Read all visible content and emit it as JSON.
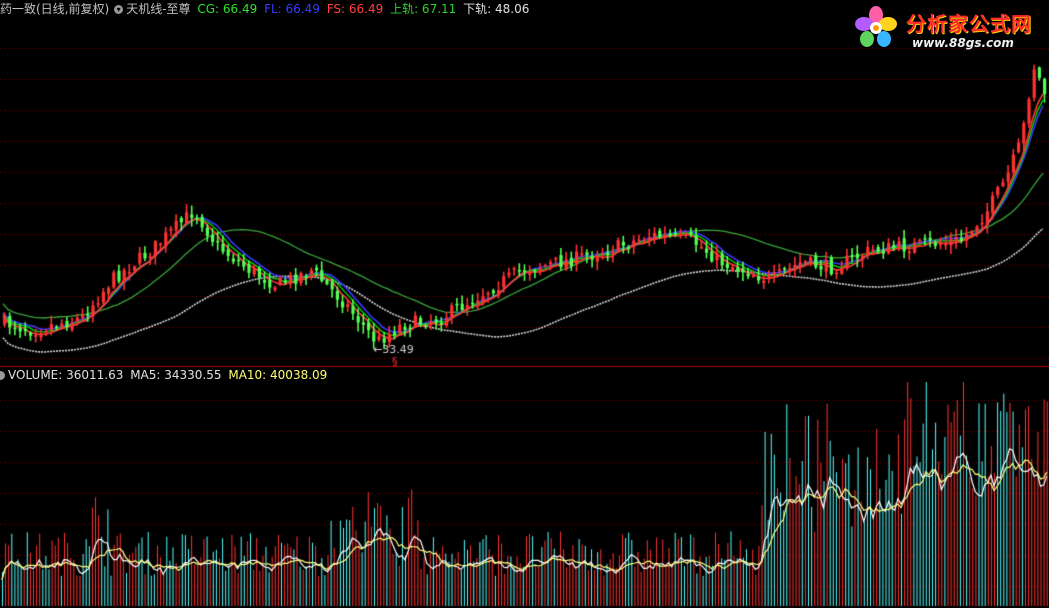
{
  "price_header": {
    "stock_name": "药一致(日线,前复权)",
    "indicator_name": "天机线-至尊",
    "cg_label": "CG: 66.49",
    "fl_label": "FL: 66.49",
    "fs_label": "FS: 66.49",
    "upper_label": "上轨: 67.11",
    "lower_label": "下轨: 48.06"
  },
  "volume_header": {
    "volume_label": "VOLUME: 36011.63",
    "ma5_label": "MA5: 34330.55",
    "ma10_label": "MA10: 40038.09"
  },
  "annotations": {
    "low_marker": "←33.49",
    "signal_marker": "§"
  },
  "logo": {
    "title": "分析家公式网",
    "url": "www.88gs.com"
  },
  "colors": {
    "background": "#000000",
    "up_candle": "#ff3232",
    "down_candle": "#54ff54",
    "cg_line": "#00e000",
    "fl_line": "#3a3aff",
    "fs_line": "#ff3a3a",
    "upper_band": "#39a339",
    "lower_band": "#d8d8d8",
    "grid": "#7a0000",
    "up_volume": "#ff3232",
    "down_volume": "#54ffff",
    "ma5_volume": "#ffffff",
    "ma10_volume": "#ffff80"
  },
  "icons": {
    "indicator_separator": "circle-chevron-down-icon"
  }
}
